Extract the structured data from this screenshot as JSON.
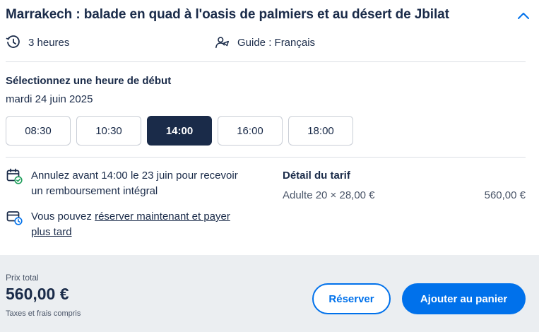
{
  "activity": {
    "title": "Marrakech : balade en quad à l'oasis de palmiers et au désert de Jbilat",
    "duration": "3 heures",
    "guide": "Guide : Français"
  },
  "icons": {
    "collapse": "chevron-up-icon",
    "duration": "clock-history-icon",
    "guide": "guide-person-icon",
    "cancel": "calendar-check-icon",
    "pay_later": "wallet-clock-icon"
  },
  "booking": {
    "start_time_label": "Sélectionnez une heure de début",
    "date": "mardi 24 juin 2025",
    "time_slots": [
      "08:30",
      "10:30",
      "14:00",
      "16:00",
      "18:00"
    ],
    "selected_time": "14:00"
  },
  "policies": {
    "cancellation": "Annulez avant 14:00 le 23 juin pour recevoir un remboursement intégral",
    "pay_later_prefix": "Vous pouvez ",
    "pay_later_link": "réserver maintenant et payer plus tard"
  },
  "price_detail": {
    "title": "Détail du tarif",
    "line_label": "Adulte 20 × 28,00 €",
    "line_amount": "560,00 €"
  },
  "footer": {
    "total_label": "Prix total",
    "total_value": "560,00 €",
    "tax_note": "Taxes et frais compris",
    "reserve_button": "Réserver",
    "cart_button": "Ajouter au panier"
  },
  "colors": {
    "primary": "#0071eb",
    "navy": "#1a2b49",
    "footer_bg": "#ebeef1",
    "check_green": "#1e9e5a"
  }
}
